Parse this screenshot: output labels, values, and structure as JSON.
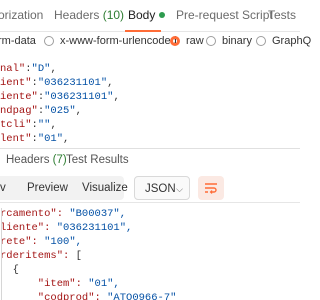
{
  "request_tabs": {
    "authorization": "orization",
    "headers": "Headers",
    "headers_count": "(10)",
    "body": "Body",
    "prerequest": "Pre-request Script",
    "tests": "Tests"
  },
  "body_options": {
    "form_data": "rm-data",
    "urlencoded": "x-www-form-urlencoded",
    "raw": "raw",
    "binary": "binary",
    "graphql": "GraphQ",
    "selected": "raw"
  },
  "request_body": [
    {
      "key": "nal\"",
      "value": "\"D\""
    },
    {
      "key": "ient\"",
      "value": "\"036231101\""
    },
    {
      "key": "iente\"",
      "value": "\"036231101\""
    },
    {
      "key": "ndpag\"",
      "value": "\"025\""
    },
    {
      "key": "tcli\"",
      "value": "\"\""
    },
    {
      "key": "lent\"",
      "value": "\"01\""
    }
  ],
  "response_tabs": {
    "headers": "Headers",
    "headers_count": "(7)",
    "test_results": "Test Results"
  },
  "response_toolbar": {
    "pretty": "v",
    "preview": "Preview",
    "visualize": "Visualize",
    "format": "JSON",
    "wrap_icon": "wrap-lines-icon"
  },
  "response_body": [
    {
      "text": "rcamento\": ",
      "value": "\"B00037\","
    },
    {
      "text": "liente\": ",
      "value": "\"036231101\","
    },
    {
      "text": "rete\": ",
      "value": "\"100\","
    },
    {
      "text": "rderitems\": ",
      "value": "["
    },
    {
      "text": "  {",
      "value": ""
    },
    {
      "text": "      \"item\": ",
      "value": "\"01\","
    },
    {
      "text": "      \"codprod\": ",
      "value": "\"ATO0966-7\""
    }
  ],
  "colors": {
    "accent": "#ff6c37",
    "status_green": "#2e9b4f",
    "json_key": "#a31515",
    "json_string": "#0451a5"
  }
}
